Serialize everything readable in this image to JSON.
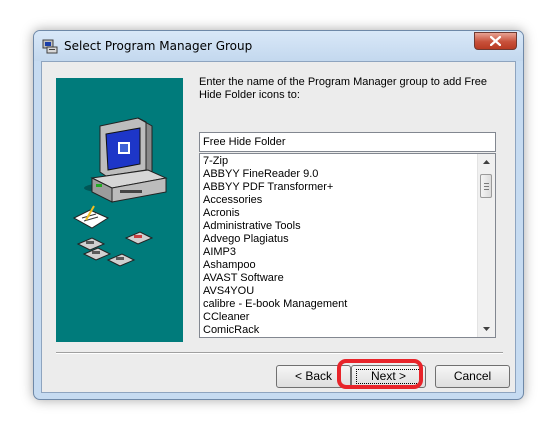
{
  "window": {
    "title": "Select Program Manager Group"
  },
  "prompt": {
    "text": "Enter the name of the Program Manager group to add Free Hide Folder icons to:"
  },
  "group_input": {
    "value": "Free Hide Folder"
  },
  "groups_list": {
    "items": [
      "7-Zip",
      "ABBYY FineReader 9.0",
      "ABBYY PDF Transformer+",
      "Accessories",
      "Acronis",
      "Administrative Tools",
      "Advego Plagiatus",
      "AIMP3",
      "Ashampoo",
      "AVAST Software",
      "AVS4YOU",
      "calibre - E-book Management",
      "CCleaner",
      "ComicRack"
    ]
  },
  "buttons": {
    "back": "< Back",
    "next": "Next >",
    "cancel": "Cancel"
  },
  "colors": {
    "art_background": "#007b7b",
    "highlight": "#e8242a",
    "close_button": "#c7503a"
  },
  "icons": {
    "title": "program-manager-icon",
    "close": "close-icon",
    "illustration": "computer-setup-illustration"
  }
}
